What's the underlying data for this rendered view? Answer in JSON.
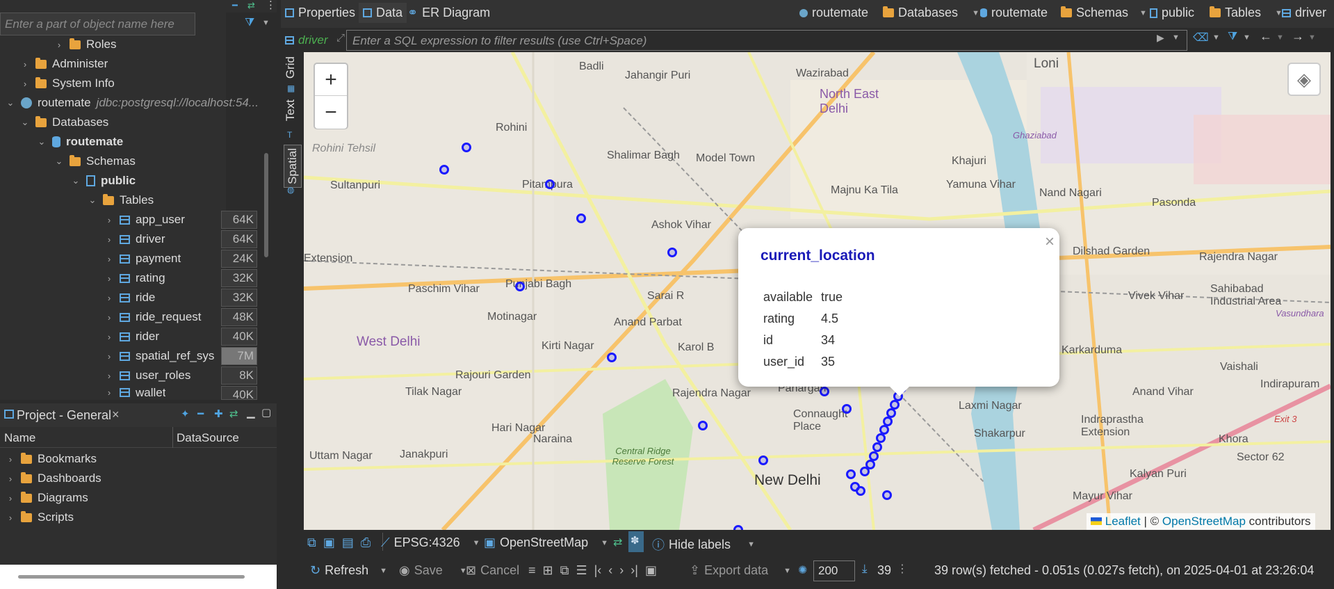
{
  "nav": {
    "filter_placeholder": "Enter a part of object name here",
    "items": [
      {
        "label": "Roles"
      },
      {
        "label": "Administer"
      },
      {
        "label": "System Info"
      },
      {
        "label": "routemate",
        "sub": "jdbc:postgresql://localhost:54..."
      },
      {
        "label": "Databases"
      },
      {
        "label": "routemate"
      },
      {
        "label": "Schemas"
      },
      {
        "label": "public"
      },
      {
        "label": "Tables"
      }
    ],
    "tables": [
      {
        "name": "app_user",
        "size": "64K"
      },
      {
        "name": "driver",
        "size": "64K"
      },
      {
        "name": "payment",
        "size": "24K"
      },
      {
        "name": "rating",
        "size": "32K"
      },
      {
        "name": "ride",
        "size": "32K"
      },
      {
        "name": "ride_request",
        "size": "48K"
      },
      {
        "name": "rider",
        "size": "40K"
      },
      {
        "name": "spatial_ref_sys",
        "size": "7M"
      },
      {
        "name": "user_roles",
        "size": "8K"
      },
      {
        "name": "wallet",
        "size": "40K"
      }
    ]
  },
  "project": {
    "title": "Project - General",
    "col_name": "Name",
    "col_source": "DataSource",
    "items": [
      "Bookmarks",
      "Dashboards",
      "Diagrams",
      "Scripts"
    ]
  },
  "editor_tabs": {
    "properties": "Properties",
    "data": "Data",
    "er": "ER Diagram"
  },
  "breadcrumb": [
    "routemate",
    "Databases",
    "routemate",
    "Schemas",
    "public",
    "Tables",
    "driver"
  ],
  "filter": {
    "entity": "driver",
    "placeholder": "Enter a SQL expression to filter results (use Ctrl+Space)"
  },
  "side_tabs": [
    "Grid",
    "Text",
    "Spatial"
  ],
  "map": {
    "zoom_in": "+",
    "zoom_out": "−",
    "attribution_leaflet": "Leaflet",
    "attribution_sep": "| ©",
    "attribution_osm": "OpenStreetMap",
    "attribution_contrib": "contributors",
    "labels": [
      "Badli",
      "Jahangir Puri",
      "Wazirabad",
      "Loni",
      "North East Delhi",
      "Rohini",
      "Rohini Tehsil",
      "Shalimar Bagh",
      "Model Town",
      "Khajuri",
      "Ghaziabad",
      "Sultanpuri",
      "Pitampura",
      "Majnu Ka Tila",
      "Yamuna Vihar",
      "Nand Nagari",
      "Pasonda",
      "Ashok Vihar",
      "Extension",
      "Dilshad Garden",
      "Rajendra Nagar",
      "Paschim Vihar",
      "Punjabi Bagh",
      "Sarai R",
      "Vivek Vihar",
      "Sahibabad Industrial Area",
      "Vasundhara",
      "Motinagar",
      "Anand Parbat",
      "West Delhi",
      "Kirti Nagar",
      "Karol B",
      "Karkarduma",
      "Rajouri Garden",
      "Vaishali",
      "Indirapuram",
      "Tilak Nagar",
      "Rajendra Nagar",
      "Panargan",
      "Laxmi Nagar",
      "Anand Vihar",
      "Connaught Place",
      "Hari Nagar",
      "Shakarpur",
      "Indraprastha Extension",
      "Khora",
      "Uttam Nagar",
      "Janakpuri",
      "Naraina",
      "Central Ridge Reserve Forest",
      "Exit 3",
      "New Delhi",
      "Kalyan Puri",
      "Sector 62",
      "Mayur Vihar"
    ]
  },
  "popup": {
    "title": "current_location",
    "close": "×",
    "rows": [
      {
        "key": "available",
        "value": "true"
      },
      {
        "key": "rating",
        "value": "4.5"
      },
      {
        "key": "id",
        "value": "34"
      },
      {
        "key": "user_id",
        "value": "35"
      }
    ]
  },
  "toolbar": {
    "crs": "EPSG:4326",
    "tiles": "OpenStreetMap",
    "hide_labels": "Hide labels",
    "refresh": "Refresh",
    "save": "Save",
    "cancel": "Cancel",
    "export": "Export data",
    "fetch_size": "200",
    "row_count": "39",
    "status": "39 row(s) fetched - 0.051s (0.027s fetch), on 2025-04-01 at 23:26:04"
  }
}
